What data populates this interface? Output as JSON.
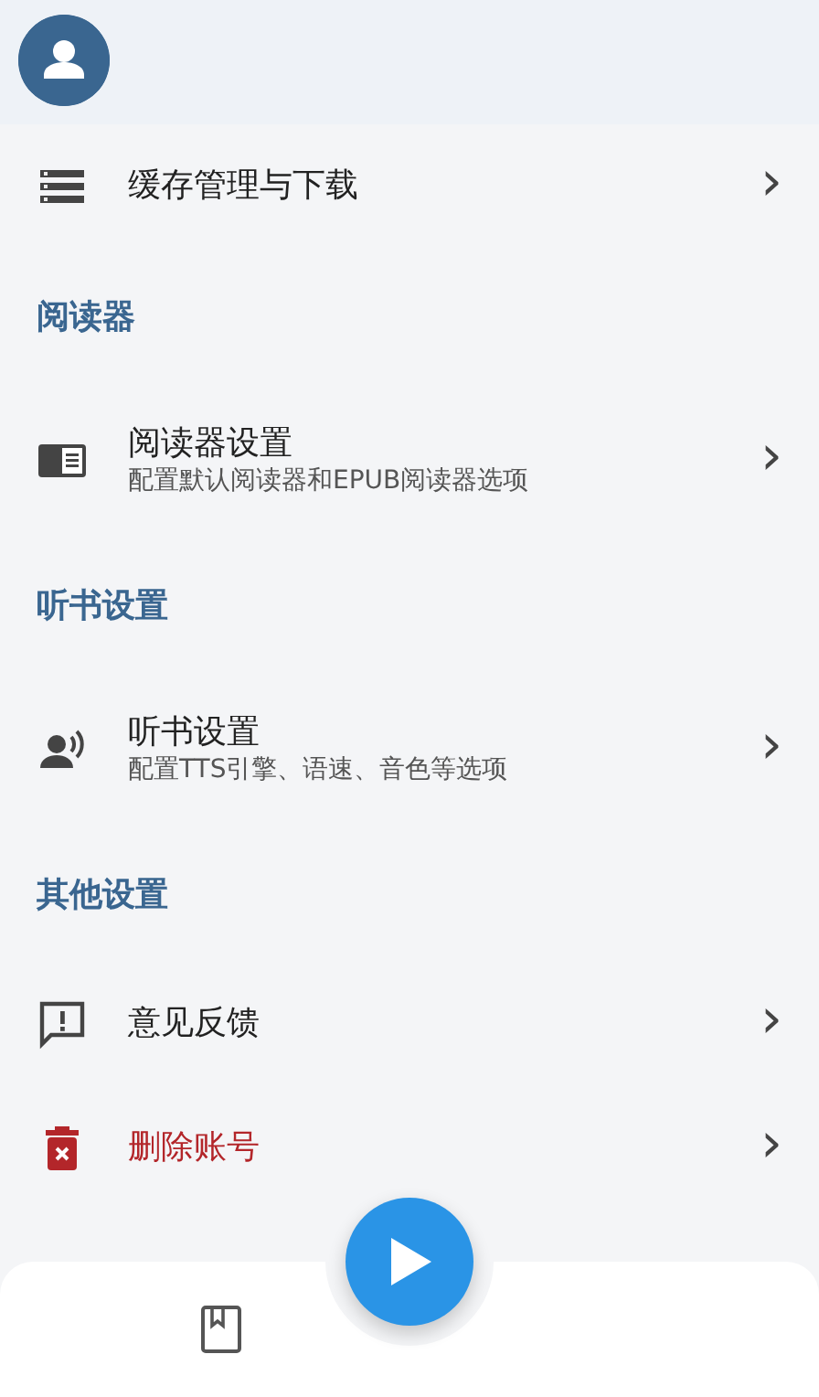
{
  "entries": [
    {
      "kind": "item",
      "title": "缓存管理与下载",
      "chevron": "›",
      "danger": false
    },
    {
      "kind": "section",
      "title": "阅读器"
    },
    {
      "kind": "item",
      "title": "阅读器设置",
      "subtitle": "配置默认阅读器和EPUB阅读器选项",
      "chevron": "›",
      "danger": false
    },
    {
      "kind": "section",
      "title": "听书设置"
    },
    {
      "kind": "item",
      "title": "听书设置",
      "subtitle": "配置TTS引擎、语速、音色等选项",
      "chevron": "›",
      "danger": false
    },
    {
      "kind": "section",
      "title": "其他设置"
    },
    {
      "kind": "item",
      "title": "意见反馈",
      "chevron": "›",
      "danger": false
    },
    {
      "kind": "item",
      "title": "删除账号",
      "chevron": "›",
      "danger": true
    }
  ]
}
